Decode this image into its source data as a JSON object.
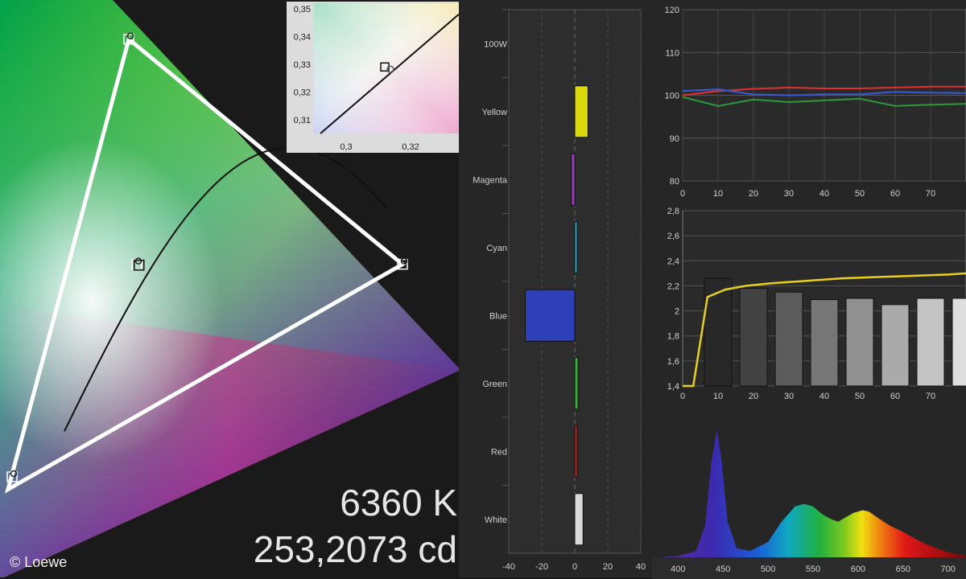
{
  "credit": "© Loewe",
  "readout": {
    "color_temp": "6360 K",
    "luminance": "253,2073 cd"
  },
  "chart_data": [
    {
      "type": "scatter",
      "chart": "cie-chromaticity-gamut",
      "gamut_triangle": {
        "red": [
          0.64,
          0.33
        ],
        "green": [
          0.3,
          0.6
        ],
        "blue": [
          0.15,
          0.06
        ]
      },
      "white_point": [
        0.3127,
        0.329
      ],
      "measured_points": [
        [
          0.64,
          0.33
        ],
        [
          0.3,
          0.6
        ],
        [
          0.155,
          0.075
        ],
        [
          0.31,
          0.33
        ]
      ],
      "blackbody_curve": true
    },
    {
      "type": "scatter",
      "chart": "white-point-zoom",
      "x_ticks": [
        "0,3",
        "0,32"
      ],
      "y_ticks": [
        "0,35",
        "0,34",
        "0,33",
        "0,32",
        "0,31"
      ],
      "xlim": [
        0.29,
        0.335
      ],
      "ylim": [
        0.305,
        0.352
      ],
      "target": [
        0.312,
        0.329
      ],
      "measured": [
        0.313,
        0.329
      ]
    },
    {
      "type": "bar",
      "chart": "color-deviation",
      "orientation": "horizontal",
      "categories": [
        "100W",
        "Yellow",
        "Magenta",
        "Cyan",
        "Blue",
        "Green",
        "Red",
        "White"
      ],
      "values": [
        0,
        8,
        -2,
        1,
        -30,
        2,
        1,
        5
      ],
      "colors": [
        "#000000",
        "#d8d80a",
        "#9a3bb8",
        "#2aaac8",
        "#2f3fb8",
        "#2fb02f",
        "#c42020",
        "#d8d8d8"
      ],
      "x_ticks": [
        "-40",
        "-20",
        "0",
        "20",
        "40"
      ],
      "xlim": [
        -40,
        40
      ]
    },
    {
      "type": "line",
      "chart": "rgb-balance",
      "x": [
        0,
        10,
        20,
        30,
        40,
        50,
        60,
        70,
        80
      ],
      "x_ticks": [
        "0",
        "10",
        "20",
        "30",
        "40",
        "50",
        "60",
        "70"
      ],
      "y_ticks": [
        "120",
        "110",
        "100",
        "90",
        "80"
      ],
      "ylim": [
        80,
        120
      ],
      "grid": true,
      "series": [
        {
          "color": "#e23030",
          "values": [
            100,
            101,
            101.5,
            101.8,
            101.6,
            101.6,
            101.8,
            102,
            102
          ]
        },
        {
          "color": "#3a5ad8",
          "values": [
            101,
            101.4,
            100.2,
            100,
            100.2,
            100.2,
            100.8,
            100.6,
            100.5
          ]
        },
        {
          "color": "#2a9a3a",
          "values": [
            99.6,
            97.5,
            99,
            98.4,
            98.8,
            99.2,
            97.5,
            97.8,
            98
          ]
        }
      ]
    },
    {
      "type": "bar",
      "chart": "gamma",
      "categories": [
        "10",
        "20",
        "30",
        "40",
        "50",
        "60",
        "70",
        "80"
      ],
      "values": [
        2.26,
        2.18,
        2.15,
        2.09,
        2.1,
        2.05,
        2.1,
        2.1
      ],
      "x_ticks": [
        "0",
        "10",
        "20",
        "30",
        "40",
        "50",
        "60",
        "70"
      ],
      "y_ticks": [
        "2,8",
        "2,6",
        "2,4",
        "2,2",
        "2",
        "1,8",
        "1,6",
        "1,4"
      ],
      "ylim": [
        1.4,
        2.8
      ],
      "curve": {
        "color": "#e8d020",
        "x": [
          0,
          3,
          7,
          12,
          18,
          25,
          35,
          45,
          55,
          65,
          75,
          80
        ],
        "values": [
          1.4,
          1.4,
          2.11,
          2.17,
          2.2,
          2.22,
          2.24,
          2.26,
          2.27,
          2.28,
          2.29,
          2.3
        ]
      }
    },
    {
      "type": "area",
      "chart": "spectrum",
      "x_ticks": [
        "400",
        "450",
        "500",
        "550",
        "600",
        "650",
        "700"
      ],
      "xlim": [
        380,
        720
      ],
      "x": [
        380,
        400,
        420,
        430,
        437,
        443,
        448,
        455,
        465,
        480,
        500,
        515,
        530,
        540,
        550,
        560,
        570,
        578,
        585,
        595,
        605,
        612,
        620,
        635,
        650,
        665,
        680,
        700,
        720
      ],
      "values": [
        0,
        0.01,
        0.05,
        0.25,
        0.75,
        1.0,
        0.78,
        0.28,
        0.07,
        0.05,
        0.12,
        0.28,
        0.4,
        0.42,
        0.4,
        0.34,
        0.3,
        0.28,
        0.31,
        0.35,
        0.37,
        0.36,
        0.32,
        0.25,
        0.2,
        0.14,
        0.09,
        0.04,
        0.01
      ]
    }
  ]
}
